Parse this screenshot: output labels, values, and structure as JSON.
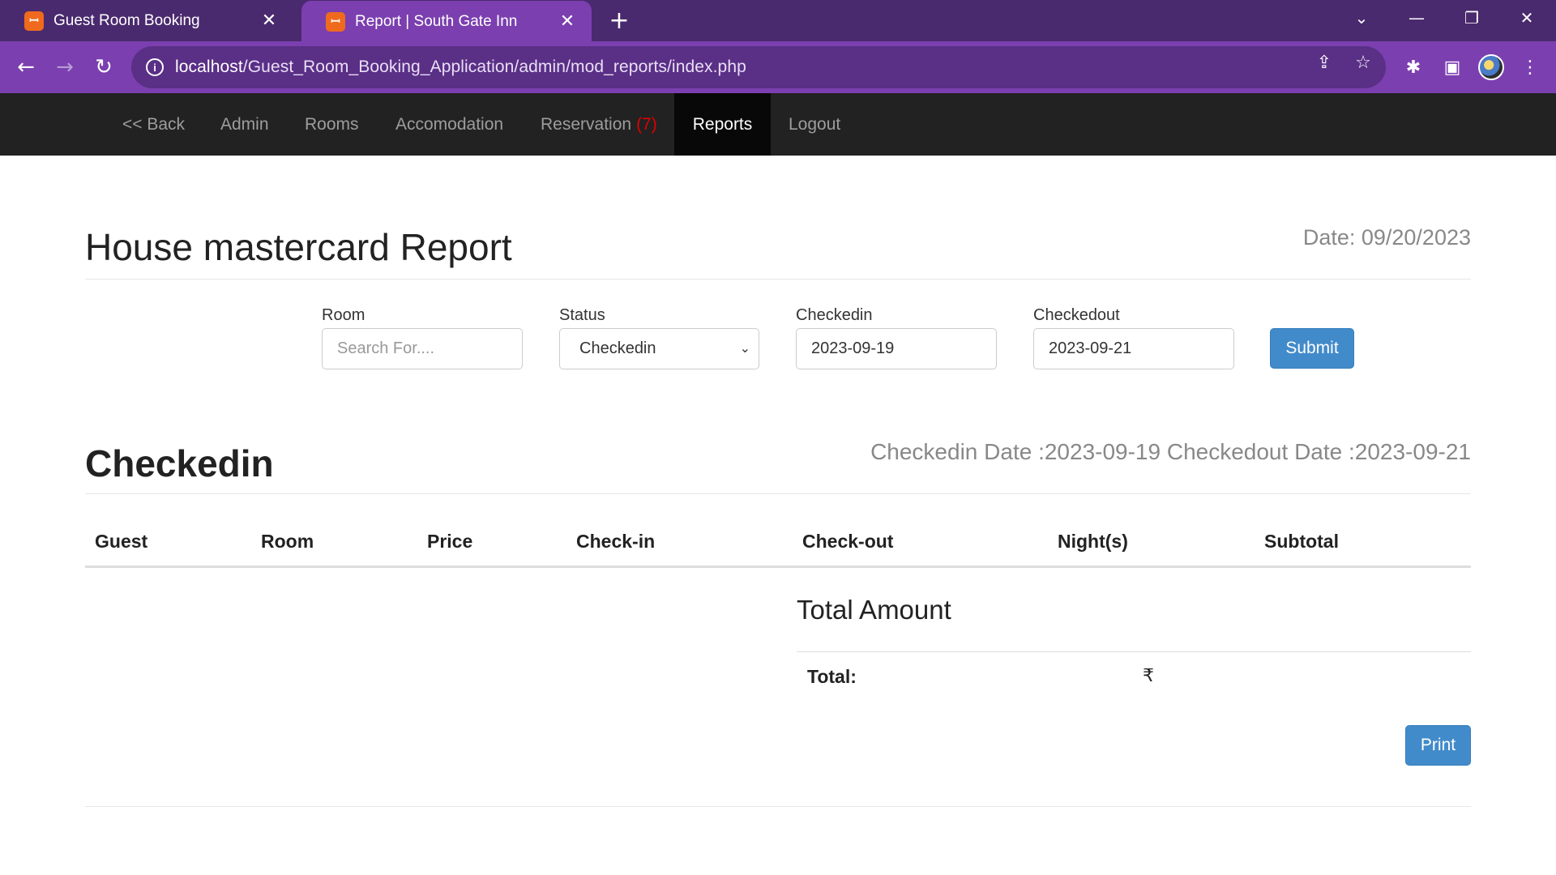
{
  "browser": {
    "tabs": [
      {
        "title": "Guest Room Booking",
        "active": false
      },
      {
        "title": "Report | South Gate Inn",
        "active": true
      }
    ],
    "url_host": "localhost",
    "url_path": "/Guest_Room_Booking_Application/admin/mod_reports/index.php",
    "favicon_glyph": "ꟷ",
    "colors": {
      "tabbar": "#4a2a6e",
      "toolbar": "#7b3fb0",
      "omnibox": "#5a2f86",
      "favicon": "#f06a1e"
    }
  },
  "nav": {
    "items": [
      {
        "label": "<< Back"
      },
      {
        "label": "Admin"
      },
      {
        "label": "Rooms"
      },
      {
        "label": "Accomodation"
      },
      {
        "label": "Reservation",
        "badge": "(7)"
      },
      {
        "label": "Reports",
        "active": true
      },
      {
        "label": "Logout"
      }
    ],
    "colors": {
      "background": "#222222",
      "active": "#080808",
      "badge": "#e00000"
    }
  },
  "report": {
    "title": "House mastercard Report",
    "date": "Date: 09/20/2023"
  },
  "form": {
    "room": {
      "label": "Room",
      "placeholder": "Search For...."
    },
    "status": {
      "label": "Status",
      "value": "Checkedin"
    },
    "checkedin": {
      "label": "Checkedin",
      "value": "2023-09-19"
    },
    "checkedout": {
      "label": "Checkedout",
      "value": "2023-09-21"
    },
    "submit_label": "Submit"
  },
  "results": {
    "title": "Checkedin",
    "range": "Checkedin Date :2023-09-19 Checkedout Date :2023-09-21",
    "columns": [
      "Guest",
      "Room",
      "Price",
      "Check-in",
      "Check-out",
      "Night(s)",
      "Subtotal"
    ],
    "rows": []
  },
  "totals": {
    "heading": "Total Amount",
    "label": "Total:",
    "currency": "₹"
  },
  "print_label": "Print",
  "accent_color": "#428bca"
}
